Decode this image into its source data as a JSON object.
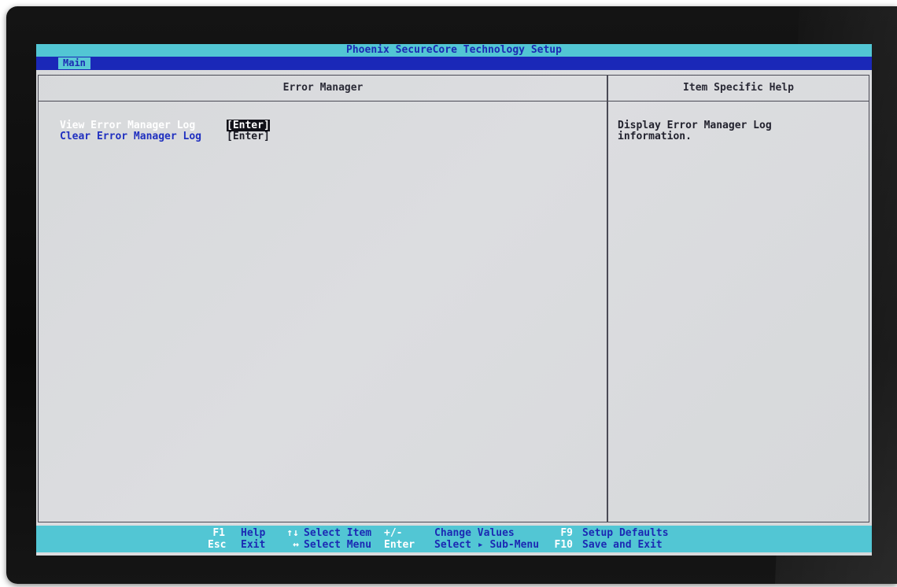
{
  "window": {
    "title": "Phoenix SecureCore Technology Setup"
  },
  "menu": {
    "tabs": [
      {
        "label": "Main",
        "active": true
      }
    ]
  },
  "main_panel": {
    "heading": "Error Manager",
    "items": [
      {
        "label": "View Error Manager Log",
        "value": "[Enter]",
        "selected": true
      },
      {
        "label": "Clear Error Manager Log",
        "value": "[Enter]",
        "selected": false
      }
    ]
  },
  "help_panel": {
    "heading": "Item Specific Help",
    "lines": [
      "Display Error Manager Log",
      "information."
    ]
  },
  "footer": {
    "row1": [
      {
        "key": "F1",
        "desc": "Help"
      },
      {
        "key": "↑↓",
        "desc": "Select Item"
      },
      {
        "key": "+/-",
        "desc": "Change Values"
      },
      {
        "key": "F9",
        "desc": "Setup Defaults"
      }
    ],
    "row2": [
      {
        "key": "Esc",
        "desc": "Exit"
      },
      {
        "key": "↔",
        "desc": "Select Menu"
      },
      {
        "key": "Enter",
        "desc": "Select ▸ Sub-Menu"
      },
      {
        "key": "F10",
        "desc": "Save and Exit"
      }
    ]
  },
  "colors": {
    "title_bar": "#52c6d4",
    "menu_bar": "#1a28b8",
    "screen_bg": "#d9dadc",
    "selected_label": "#ffffff",
    "item_label": "#2030c0",
    "footer_key": "#ffffff",
    "footer_desc": "#1c2ab3"
  }
}
